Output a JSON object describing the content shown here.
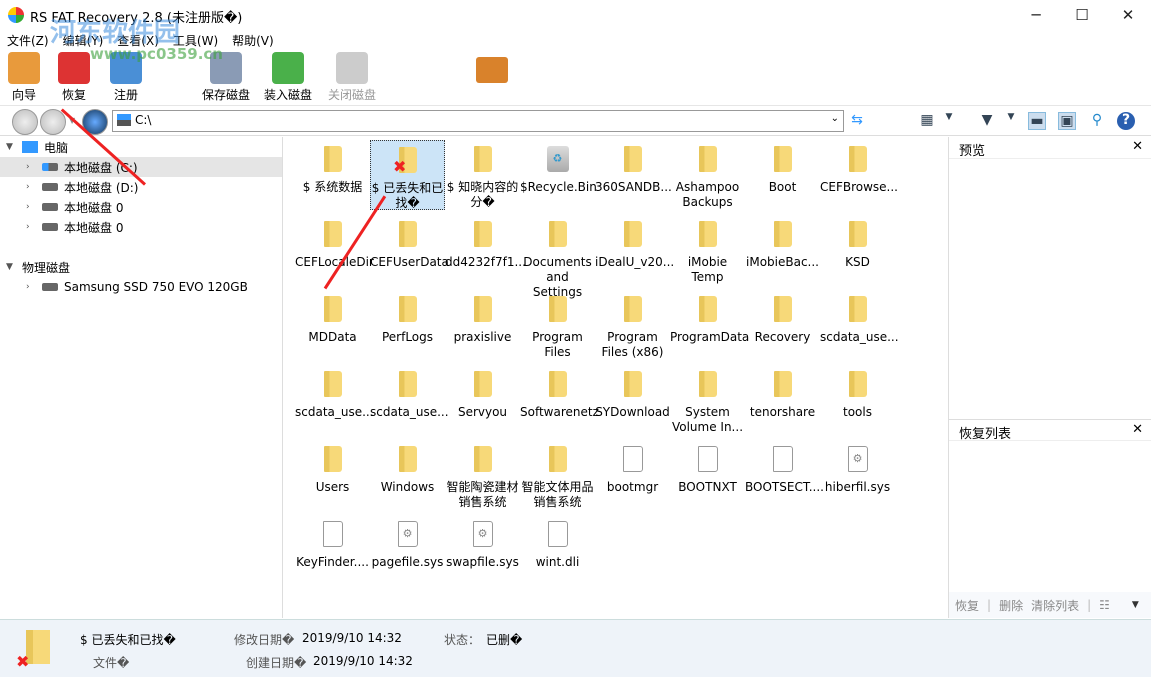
{
  "window": {
    "title": "RS FAT Recovery 2.8 (未注册版�)",
    "minimize": "─",
    "maximize": "☐",
    "close": "✕"
  },
  "watermark": {
    "line1": "河东软件园",
    "line2": "www.pc0359.cn"
  },
  "menu": [
    "文件(Z)",
    "编辑(Y)",
    "查看(X)",
    "工具(W)",
    "帮助(V)"
  ],
  "toolbar": [
    {
      "label": "向导",
      "color": "#e89a3c"
    },
    {
      "label": "恢复",
      "color": "#d33"
    },
    {
      "label": "注册",
      "color": "#4a8fd6"
    },
    {
      "label": "保存磁盘",
      "color": "#8a9bb5"
    },
    {
      "label": "装入磁盘",
      "color": "#4ab04a"
    },
    {
      "label": "关闭磁盘",
      "color": "#ccc",
      "disabled": true
    }
  ],
  "address": {
    "path": "C:\\"
  },
  "tree": {
    "computer": "电脑",
    "drives": [
      "本地磁盘 (C:)",
      "本地磁盘 (D:)",
      "本地磁盘 0",
      "本地磁盘 0"
    ],
    "physical": "物理磁盘",
    "disks": [
      "Samsung SSD 750 EVO 120GB"
    ]
  },
  "files": [
    {
      "name": "$ 系统数据",
      "type": "folder"
    },
    {
      "name": "$ 已丢失和已找�",
      "type": "folder",
      "deleted": true,
      "selected": true
    },
    {
      "name": "$ 知晓内容的分�",
      "type": "folder"
    },
    {
      "name": "$Recycle.Bin",
      "type": "bin"
    },
    {
      "name": "360SANDB...",
      "type": "folder"
    },
    {
      "name": "Ashampoo Backups",
      "type": "folder"
    },
    {
      "name": "Boot",
      "type": "folder"
    },
    {
      "name": "CEFBrowse...",
      "type": "folder"
    },
    {
      "name": "CEFLocaleDir",
      "type": "folder"
    },
    {
      "name": "CEFUserData",
      "type": "folder"
    },
    {
      "name": "dd4232f7f1...",
      "type": "folder"
    },
    {
      "name": "Documents and Settings",
      "type": "folder"
    },
    {
      "name": "iDealU_v20...",
      "type": "folder"
    },
    {
      "name": "iMobie Temp",
      "type": "folder"
    },
    {
      "name": "iMobieBac...",
      "type": "folder"
    },
    {
      "name": "KSD",
      "type": "folder"
    },
    {
      "name": "MDData",
      "type": "folder"
    },
    {
      "name": "PerfLogs",
      "type": "folder"
    },
    {
      "name": "praxislive",
      "type": "folder"
    },
    {
      "name": "Program Files",
      "type": "folder"
    },
    {
      "name": "Program Files (x86)",
      "type": "folder"
    },
    {
      "name": "ProgramData",
      "type": "folder"
    },
    {
      "name": "Recovery",
      "type": "folder"
    },
    {
      "name": "scdata_use...",
      "type": "folder"
    },
    {
      "name": "scdata_use...",
      "type": "folder"
    },
    {
      "name": "scdata_use...",
      "type": "folder"
    },
    {
      "name": "Servyou",
      "type": "folder"
    },
    {
      "name": "Softwarenetz",
      "type": "folder"
    },
    {
      "name": "SYDownload",
      "type": "folder"
    },
    {
      "name": "System Volume In...",
      "type": "folder"
    },
    {
      "name": "tenorshare",
      "type": "folder"
    },
    {
      "name": "tools",
      "type": "folder"
    },
    {
      "name": "Users",
      "type": "folder"
    },
    {
      "name": "Windows",
      "type": "folder"
    },
    {
      "name": "智能陶瓷建材销售系统",
      "type": "folder"
    },
    {
      "name": "智能文体用品销售系统",
      "type": "folder"
    },
    {
      "name": "bootmgr",
      "type": "file"
    },
    {
      "name": "BOOTNXT",
      "type": "file"
    },
    {
      "name": "BOOTSECT....",
      "type": "file"
    },
    {
      "name": "hiberfil.sys",
      "type": "sys"
    },
    {
      "name": "KeyFinder....",
      "type": "file"
    },
    {
      "name": "pagefile.sys",
      "type": "sys"
    },
    {
      "name": "swapfile.sys",
      "type": "sys"
    },
    {
      "name": "wint.dli",
      "type": "file"
    }
  ],
  "preview": {
    "title": "预览",
    "close": "✕"
  },
  "recovery_list": {
    "title": "恢复列表",
    "close": "✕",
    "buttons": [
      "恢复",
      "删除",
      "清除列表"
    ]
  },
  "status": {
    "name": "$ 已丢失和已找�",
    "type": "文件�",
    "modified_label": "修改日期�",
    "modified": "2019/9/10 14:32",
    "created_label": "创建日期�",
    "created": "2019/9/10 14:32",
    "state_label": "状态：",
    "state": "已删�"
  }
}
